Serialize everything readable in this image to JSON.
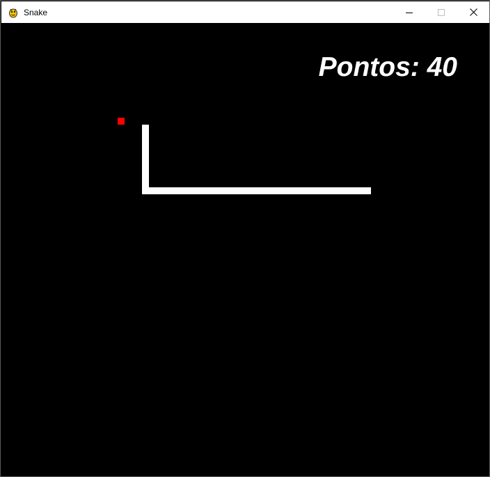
{
  "window": {
    "title": "Snake",
    "icon": "pygame-snake-icon",
    "controls": [
      "minimize",
      "maximize",
      "close"
    ]
  },
  "game": {
    "score_label": "Pontos: 40",
    "colors": {
      "background": "#000000",
      "snake": "#ffffff",
      "food": "#ff0000",
      "score": "#ffffff"
    }
  }
}
